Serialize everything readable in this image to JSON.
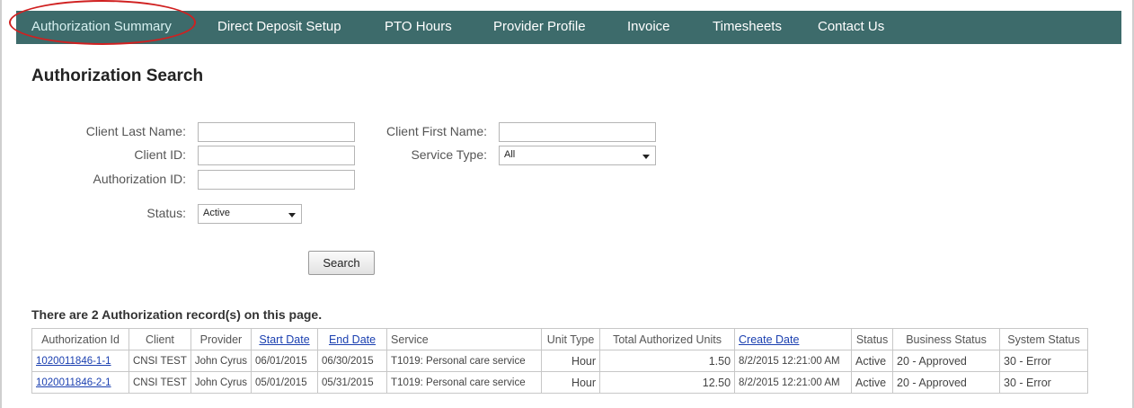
{
  "nav": {
    "items": [
      {
        "label": "Authorization Summary",
        "active": true
      },
      {
        "label": "Direct Deposit Setup"
      },
      {
        "label": "PTO Hours"
      },
      {
        "label": "Provider Profile"
      },
      {
        "label": "Invoice"
      },
      {
        "label": "Timesheets"
      },
      {
        "label": "Contact Us"
      }
    ],
    "bg_color": "#3d6b6b",
    "highlight_color": "#d02020"
  },
  "page": {
    "title": "Authorization Search"
  },
  "form": {
    "client_last_name": {
      "label": "Client Last Name:",
      "value": ""
    },
    "client_first_name": {
      "label": "Client First Name:",
      "value": ""
    },
    "client_id": {
      "label": "Client ID:",
      "value": ""
    },
    "service_type": {
      "label": "Service Type:",
      "value": "All"
    },
    "authorization_id": {
      "label": "Authorization ID:",
      "value": ""
    },
    "status": {
      "label": "Status:",
      "value": "Active"
    },
    "search_button": "Search"
  },
  "results": {
    "message": "There are 2 Authorization record(s) on this page.",
    "columns": [
      "Authorization Id",
      "Client",
      "Provider",
      "Start Date",
      "End Date",
      "Service",
      "Unit Type",
      "Total Authorized Units",
      "Create Date",
      "Status",
      "Business Status",
      "System Status"
    ],
    "rows": [
      {
        "authorization_id": "1020011846-1-1",
        "client": "CNSI TEST",
        "provider": "John Cyrus",
        "start_date": "06/01/2015",
        "end_date": "06/30/2015",
        "service": "T1019: Personal care service",
        "unit_type": "Hour",
        "total_units": "1.50",
        "create_date": "8/2/2015 12:21:00 AM",
        "status": "Active",
        "business_status": "20 - Approved",
        "system_status": "30 - Error"
      },
      {
        "authorization_id": "1020011846-2-1",
        "client": "CNSI TEST",
        "provider": "John Cyrus",
        "start_date": "05/01/2015",
        "end_date": "05/31/2015",
        "service": "T1019: Personal care service",
        "unit_type": "Hour",
        "total_units": "12.50",
        "create_date": "8/2/2015 12:21:00 AM",
        "status": "Active",
        "business_status": "20 - Approved",
        "system_status": "30 - Error"
      }
    ]
  }
}
